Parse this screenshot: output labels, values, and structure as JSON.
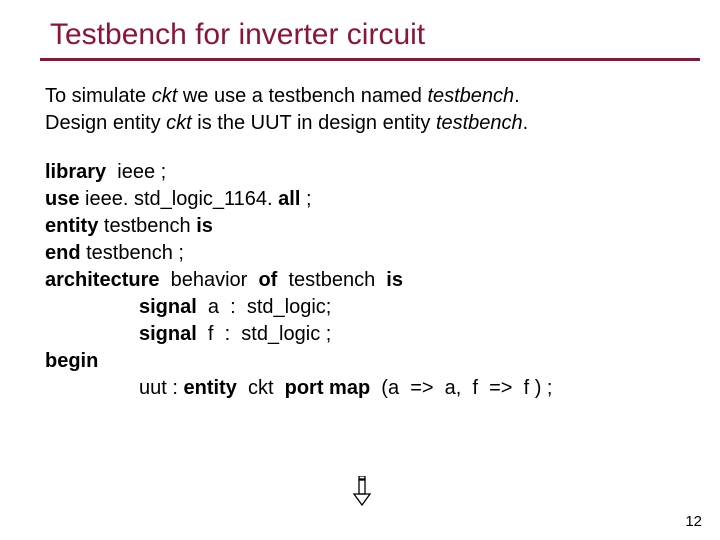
{
  "title": "Testbench for inverter circuit",
  "intro": {
    "l1a": "To simulate ",
    "l1b": "ckt",
    "l1c": " we use a testbench named ",
    "l1d": "testbench",
    "l1e": ".",
    "l2a": "Design entity ",
    "l2b": "ckt",
    "l2c": " is the UUT in design entity ",
    "l2d": "testbench",
    "l2e": "."
  },
  "code": {
    "l1a": "library ",
    "l1b": " ieee ;",
    "l2a": "use",
    "l2b": " ieee. std_logic_1164. ",
    "l2c": "all",
    "l2d": " ;",
    "l3a": "entity ",
    "l3b": "testbench ",
    "l3c": "is",
    "l4a": "end",
    "l4b": " testbench ;",
    "l5a": "architecture ",
    "l5b": " behavior ",
    "l5c": " of ",
    "l5d": " testbench ",
    "l5e": " is",
    "l6a": "signal ",
    "l6b": " a  :  std_logic;",
    "l7a": "signal ",
    "l7b": " f  :  std_logic ;",
    "l8a": "begin",
    "l9a": "uut : ",
    "l9b": "entity ",
    "l9c": " ckt ",
    "l9d": " port map ",
    "l9e": " (a  =>  a,  f  =>  f ) ;"
  },
  "pagenum": "12"
}
